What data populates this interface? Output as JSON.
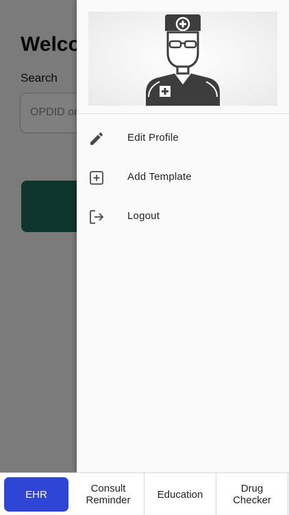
{
  "background": {
    "title": "Welco",
    "search_label": "Search",
    "search_placeholder": "OPDID or"
  },
  "drawer": {
    "avatar_icon": "doctor-avatar-icon",
    "menu": [
      {
        "label": "Edit Profile",
        "icon": "pencil-icon"
      },
      {
        "label": "Add Template",
        "icon": "add-box-icon"
      },
      {
        "label": "Logout",
        "icon": "logout-icon"
      }
    ]
  },
  "bottom_nav": {
    "active": "EHR",
    "tabs": [
      {
        "label": "EHR"
      },
      {
        "label": "Consult\nReminder"
      },
      {
        "label": "Education"
      },
      {
        "label": "Drug\nChecker"
      }
    ]
  },
  "colors": {
    "accent": "#2f45d6",
    "primary_button": "#1f6b5e",
    "icon_gray": "#4a4a4a"
  }
}
